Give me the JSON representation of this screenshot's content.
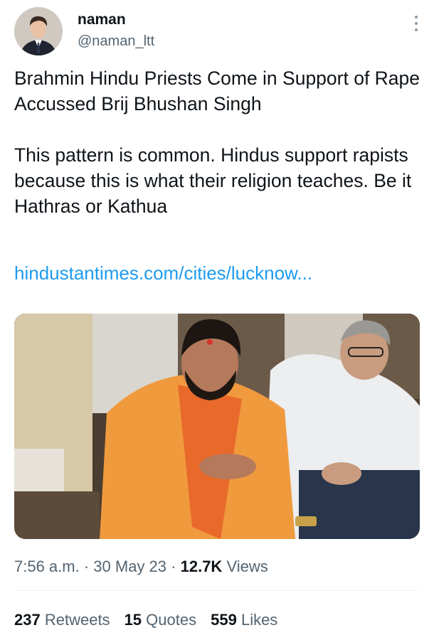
{
  "author": {
    "display_name": "naman",
    "handle": "@naman_ltt"
  },
  "tweet": {
    "text_line1": "Brahmin Hindu Priests Come in Support of Rape Accussed Brij Bhushan Singh",
    "text_para2": "This pattern is common. Hindus support rapists because this is what their religion teaches. Be it Hathras or Kathua",
    "link_text": "hindustantimes.com/cities/lucknow..."
  },
  "meta": {
    "time": "7:56 a.m.",
    "separator": "·",
    "date": "30 May 23",
    "views_count": "12.7K",
    "views_label": "Views"
  },
  "stats": {
    "retweets_count": "237",
    "retweets_label": "Retweets",
    "quotes_count": "15",
    "quotes_label": "Quotes",
    "likes_count": "559",
    "likes_label": "Likes"
  },
  "icons": {
    "more": "more-options-icon"
  },
  "colors": {
    "link": "#1d9bf0",
    "secondary_text": "#536471",
    "primary_text": "#0f1419"
  }
}
